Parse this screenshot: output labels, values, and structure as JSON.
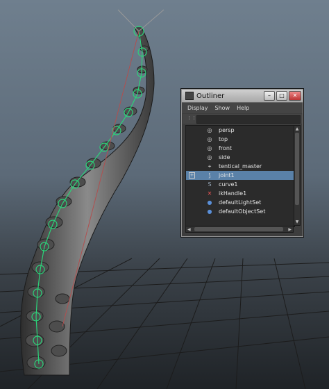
{
  "outliner": {
    "title": "Outliner",
    "menu": [
      "Display",
      "Show",
      "Help"
    ],
    "items": [
      {
        "label": "persp",
        "icon": "camera-icon",
        "glyph": "◎"
      },
      {
        "label": "top",
        "icon": "camera-icon",
        "glyph": "◎"
      },
      {
        "label": "front",
        "icon": "camera-icon",
        "glyph": "◎"
      },
      {
        "label": "side",
        "icon": "camera-icon",
        "glyph": "◎"
      },
      {
        "label": "tentical_master",
        "icon": "group-icon",
        "glyph": "⌖"
      },
      {
        "label": "joint1",
        "icon": "joint-icon",
        "glyph": "⟆",
        "selected": true
      },
      {
        "label": "curve1",
        "icon": "curve-icon",
        "glyph": "S"
      },
      {
        "label": "ikHandle1",
        "icon": "ik-handle-icon",
        "glyph": "✕"
      },
      {
        "label": "defaultLightSet",
        "icon": "set-icon",
        "glyph": "●"
      },
      {
        "label": "defaultObjectSet",
        "icon": "set-icon",
        "glyph": "●"
      }
    ]
  },
  "colors": {
    "selection": "#5a81a8",
    "joint_green": "#2bd47a"
  }
}
